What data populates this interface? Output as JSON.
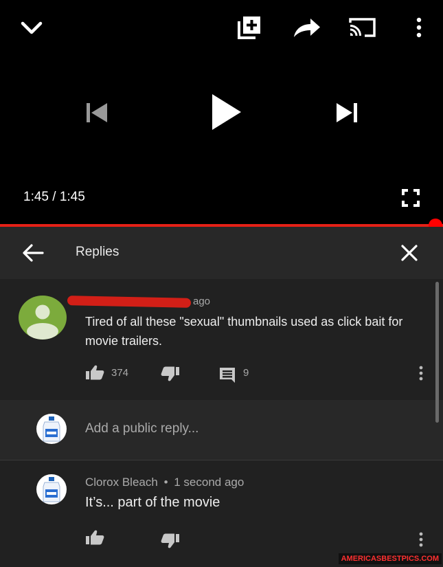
{
  "player": {
    "time_current": "1:45",
    "time_separator": "/",
    "time_total": "1:45",
    "progress_fraction": 1.0,
    "icons": [
      "chevron-down-icon",
      "add-to-playlist-icon",
      "share-icon",
      "cast-icon",
      "more-vert-icon",
      "previous-icon",
      "play-icon",
      "next-icon",
      "fullscreen-icon"
    ]
  },
  "replies_panel": {
    "title": "Replies",
    "back_icon": "arrow-left-icon",
    "close_icon": "close-icon"
  },
  "parent_comment": {
    "time_ago": "ago",
    "text": "Tired of all these \"sexual\" thumbnails used as click bait for movie trailers.",
    "likes": "374",
    "replies": "9"
  },
  "reply_input": {
    "placeholder": "Add a public reply..."
  },
  "reply": {
    "author": "Clorox Bleach",
    "separator": "•",
    "time_ago": "1 second ago",
    "text": "It’s... part of the movie"
  },
  "watermark": "AMERICASBESTPICS.COM",
  "colors": {
    "progress": "#e52117",
    "panel_bg": "#212121",
    "header_bg": "#282828",
    "avatar_green": "#7cab3c",
    "redaction": "#d21f17"
  }
}
